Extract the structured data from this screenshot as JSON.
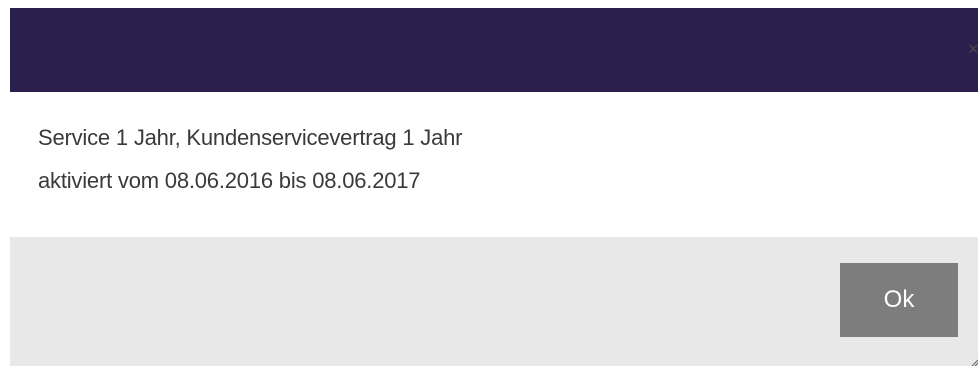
{
  "dialog": {
    "close_icon": "×",
    "lines": [
      "Service 1 Jahr, Kundenservicevertrag 1 Jahr",
      "aktiviert vom 08.06.2016 bis 08.06.2017"
    ],
    "ok_label": "Ok",
    "icons": {
      "close": "close-icon",
      "resize": "resize-handle-icon"
    }
  },
  "colors": {
    "header": "#2a1f4d",
    "footer": "#e8e8e8",
    "button": "#7d7d7d",
    "text": "#3a3a3a"
  }
}
